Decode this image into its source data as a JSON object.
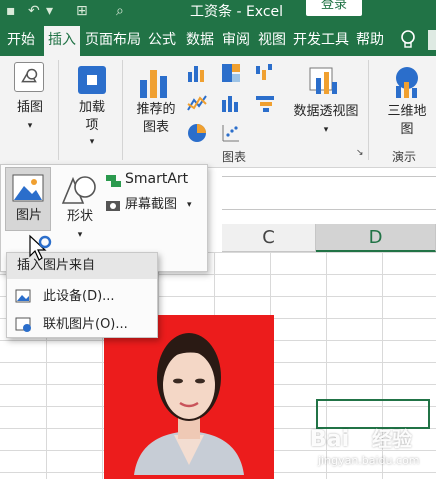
{
  "titlebar": {
    "doc_title": "工资条 - Excel",
    "login_label": "登录"
  },
  "tabs": [
    {
      "label": "开始",
      "active": false
    },
    {
      "label": "插入",
      "active": true
    },
    {
      "label": "页面布局",
      "active": false
    },
    {
      "label": "公式",
      "active": false
    },
    {
      "label": "数据",
      "active": false
    },
    {
      "label": "审阅",
      "active": false
    },
    {
      "label": "视图",
      "active": false
    },
    {
      "label": "开发工具",
      "active": false
    },
    {
      "label": "帮助",
      "active": false
    }
  ],
  "ribbon": {
    "illustrations_label": "插图",
    "addins_label_1": "加载",
    "addins_label_2": "项",
    "recommended_charts_1": "推荐的",
    "recommended_charts_2": "图表",
    "pivot_chart": "数据透视图",
    "map_3d_1": "三维地",
    "map_3d_2": "图",
    "group_charts": "图表",
    "group_tours": "演示"
  },
  "illustrations_panel": {
    "pictures_label": "图片",
    "shapes_label": "形状",
    "smartart_label": "SmartArt",
    "screenshot_label": "屏幕截图"
  },
  "insert_menu": {
    "header": "插入图片来自",
    "items": [
      {
        "label": "此设备(D)..."
      },
      {
        "label": "联机图片(O)..."
      }
    ]
  },
  "sheet": {
    "columns": [
      "C",
      "D"
    ]
  },
  "watermark": {
    "url": "jingyan.baidu.com"
  },
  "colors": {
    "excel_green": "#217346",
    "photo_bg": "#ec1c1c"
  }
}
